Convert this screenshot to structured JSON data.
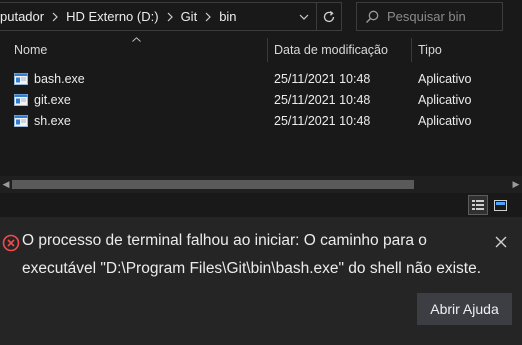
{
  "explorer": {
    "breadcrumbs": [
      {
        "label": "putador"
      },
      {
        "label": "HD Externo (D:)"
      },
      {
        "label": "Git"
      },
      {
        "label": "bin"
      }
    ],
    "search": {
      "placeholder": "Pesquisar bin"
    },
    "columns": {
      "name": "Nome",
      "date": "Data de modificação",
      "type": "Tipo"
    },
    "files": [
      {
        "name": "bash.exe",
        "date": "25/11/2021 10:48",
        "type": "Aplicativo"
      },
      {
        "name": "git.exe",
        "date": "25/11/2021 10:48",
        "type": "Aplicativo"
      },
      {
        "name": "sh.exe",
        "date": "25/11/2021 10:48",
        "type": "Aplicativo"
      }
    ]
  },
  "notification": {
    "message": "O processo de terminal falhou ao iniciar: O caminho para o executável \"D:\\Program Files\\Git\\bin\\bash.exe\" do shell não existe.",
    "help_label": "Abrir Ajuda"
  },
  "colors": {
    "background": "#191919",
    "notification_bg": "#252526",
    "error": "#f14c4c",
    "button_bg": "#3d3d44"
  }
}
